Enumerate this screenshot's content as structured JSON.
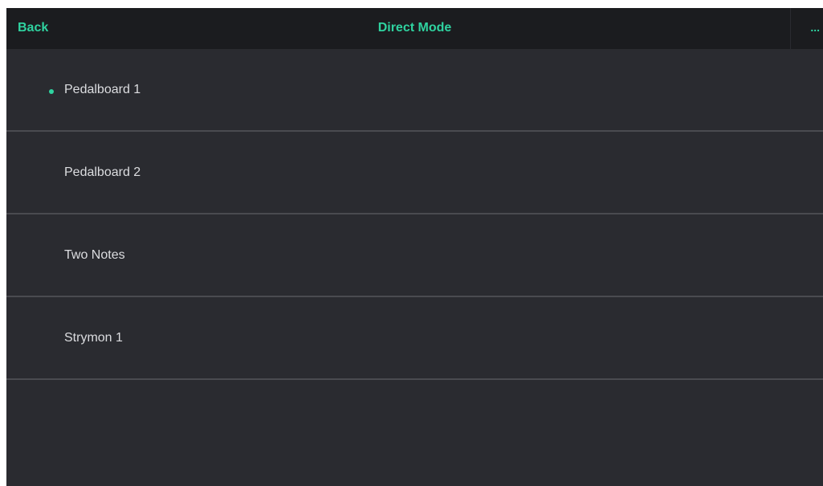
{
  "header": {
    "back_label": "Back",
    "title": "Direct Mode",
    "more_label": "..."
  },
  "pedalboards": [
    {
      "label": "Pedalboard 1",
      "active": true
    },
    {
      "label": "Pedalboard 2",
      "active": false
    },
    {
      "label": "Two Notes",
      "active": false
    },
    {
      "label": "Strymon 1",
      "active": false
    }
  ],
  "colors": {
    "accent": "#2fd3a0",
    "header_bg": "#1b1c1f",
    "list_bg": "#2a2b30",
    "divider": "#4a4b50",
    "text": "#dcdde0"
  }
}
